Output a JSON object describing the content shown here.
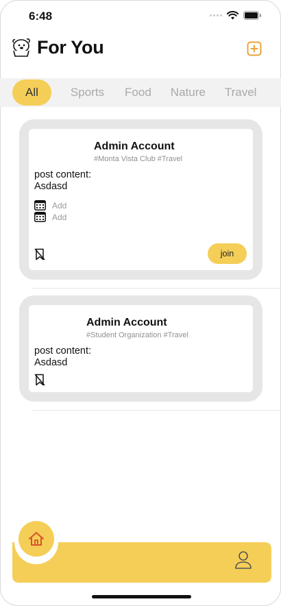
{
  "status_bar": {
    "time": "6:48"
  },
  "header": {
    "title": "For You",
    "mascot_icon": "mascot-icon",
    "add_icon": "add-square-icon"
  },
  "categories": [
    "All",
    "Sports",
    "Food",
    "Nature",
    "Travel"
  ],
  "active_category": "All",
  "posts": [
    {
      "author": "Admin Account",
      "tags": "#Monta Vista Club  #Travel",
      "content_label": "post content:",
      "content": "Asdasd",
      "add_items": [
        "Add",
        "Add"
      ],
      "join_label": "join"
    },
    {
      "author": "Admin Account",
      "tags": "#Student Organization  #Travel",
      "content_label": "post content:",
      "content": "Asdasd"
    }
  ],
  "tab_bar": {
    "home_icon": "home-icon",
    "profile_icon": "profile-icon"
  },
  "colors": {
    "accent": "#f5ce57",
    "card_border": "#e6e6e6",
    "icon_orange": "#e8a33a",
    "home_icon": "#d9532b"
  }
}
